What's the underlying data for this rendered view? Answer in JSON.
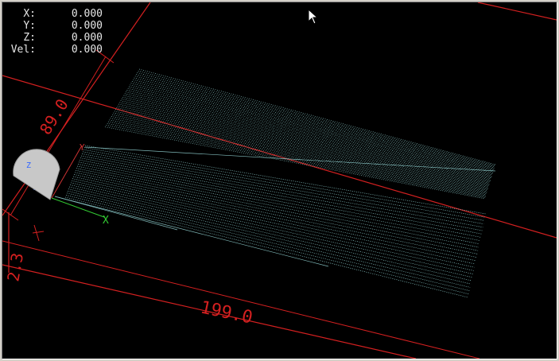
{
  "dro": [
    {
      "label": "X:",
      "value": "0.000"
    },
    {
      "label": "Y:",
      "value": "0.000"
    },
    {
      "label": "Z:",
      "value": "0.000"
    },
    {
      "label": "Vel:",
      "value": "0.000"
    }
  ],
  "dimensions": {
    "x_extent": "199.0",
    "y_extent": "89.0",
    "z_extent": "2.3"
  },
  "axes": {
    "x_label": "X",
    "y_label": "Y",
    "z_label": "Z"
  },
  "colors": {
    "background": "#000000",
    "limit_box": "#d42020",
    "toolpath": "#7fb8b8",
    "x_axis": "#33cc33",
    "y_axis": "#cc3333",
    "z_axis": "#3366ff",
    "tool": "#c8c8c8",
    "dro_text": "#e6e6e6"
  },
  "icons": [
    "mouse-pointer-icon",
    "tool-cone-icon"
  ]
}
